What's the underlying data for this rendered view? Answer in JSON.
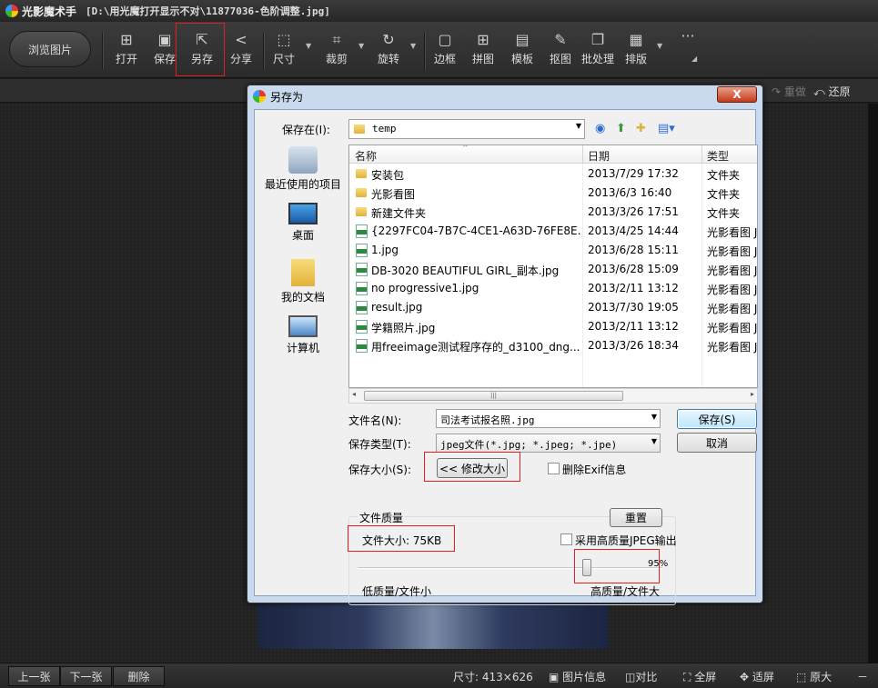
{
  "app": {
    "title": "光影魔术手",
    "document": "[D:\\用光魔打开显示不对\\11877036-色阶调整.jpg]"
  },
  "toolbar": {
    "browse": "浏览图片",
    "open": "打开",
    "save": "保存",
    "save_as": "另存",
    "share": "分享",
    "size": "尺寸",
    "crop": "裁剪",
    "rotate": "旋转",
    "border": "边框",
    "collage": "拼图",
    "template": "模板",
    "cutout": "抠图",
    "batch": "批处理",
    "layout": "排版",
    "more": "···"
  },
  "subbar": {
    "redo": "重做",
    "restore": "还原"
  },
  "statusbar": {
    "prev": "上一张",
    "next": "下一张",
    "delete": "删除",
    "size": "尺寸: 413×626",
    "info": "图片信息",
    "compare": "对比",
    "fullscreen": "全屏",
    "fit": "适屏",
    "original": "原大",
    "minimize": "－"
  },
  "dialog": {
    "title": "另存为",
    "close": "X",
    "save_in_label": "保存在(I):",
    "save_in_value": "temp",
    "places": [
      "最近使用的项目",
      "桌面",
      "我的文档",
      "计算机"
    ],
    "columns": {
      "name": "名称",
      "date": "日期",
      "type": "类型"
    },
    "files": [
      {
        "name": "安装包",
        "date": "2013/7/29 17:32",
        "type": "文件夹",
        "kind": "folder"
      },
      {
        "name": "光影看图",
        "date": "2013/6/3 16:40",
        "type": "文件夹",
        "kind": "folder"
      },
      {
        "name": "新建文件夹",
        "date": "2013/3/26 17:51",
        "type": "文件夹",
        "kind": "folder"
      },
      {
        "name": "{2297FC04-7B7C-4CE1-A63D-76FE8E...",
        "date": "2013/4/25 14:44",
        "type": "光影看图 J",
        "kind": "jpg"
      },
      {
        "name": "1.jpg",
        "date": "2013/6/28 15:11",
        "type": "光影看图 J",
        "kind": "jpg"
      },
      {
        "name": "DB-3020 BEAUTIFUL GIRL_副本.jpg",
        "date": "2013/6/28 15:09",
        "type": "光影看图 J",
        "kind": "jpg"
      },
      {
        "name": "no progressive1.jpg",
        "date": "2013/2/11 13:12",
        "type": "光影看图 J",
        "kind": "jpg"
      },
      {
        "name": "result.jpg",
        "date": "2013/7/30 19:05",
        "type": "光影看图 J",
        "kind": "jpg"
      },
      {
        "name": "学籍照片.jpg",
        "date": "2013/2/11 13:12",
        "type": "光影看图 J",
        "kind": "jpg"
      },
      {
        "name": "用freeimage测试程序存的_d3100_dng....",
        "date": "2013/3/26 18:34",
        "type": "光影看图 J",
        "kind": "jpg"
      }
    ],
    "filename_label": "文件名(N):",
    "filename_value": "司法考试报名照.jpg",
    "filetype_label": "保存类型(T):",
    "filetype_value": "jpeg文件(*.jpg; *.jpeg; *.jpe)",
    "savesize_label": "保存大小(S):",
    "resize_button": "<< 修改大小",
    "delete_exif": "删除Exif信息",
    "save_button": "保存(S)",
    "cancel_button": "取消",
    "quality_group": "文件质量",
    "reset_button": "重置",
    "file_size": "文件大小: 75KB",
    "hq_jpeg": "采用高质量JPEG输出",
    "quality_value": "95%",
    "quality_level": 0.95,
    "low_label": "低质量/文件小",
    "high_label": "高质量/文件大"
  },
  "colors": {
    "highlight": "#e02020",
    "dialog_frame": "#c9d9ee",
    "app_bg": "#1e1e1e"
  }
}
